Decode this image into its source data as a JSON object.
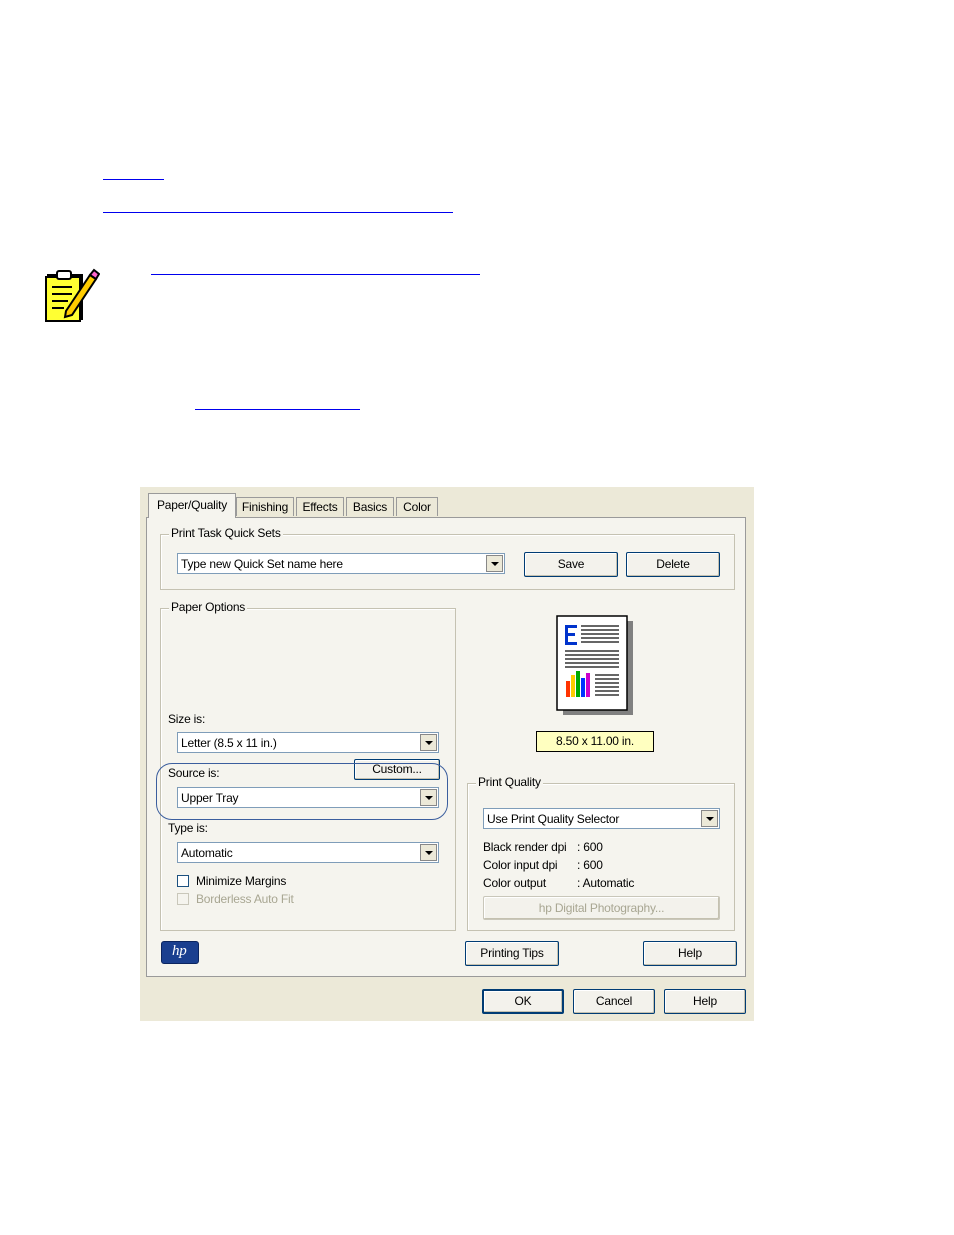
{
  "dialog": {
    "tabs": [
      {
        "label": "Paper/Quality",
        "active": true
      },
      {
        "label": "Finishing"
      },
      {
        "label": "Effects"
      },
      {
        "label": "Basics"
      },
      {
        "label": "Color"
      }
    ],
    "quick_sets": {
      "title": "Print Task Quick Sets",
      "value": "Type new Quick Set name here",
      "save_label": "Save",
      "delete_label": "Delete"
    },
    "paper_options": {
      "title": "Paper Options",
      "size_label": "Size is:",
      "size_value": "Letter (8.5 x 11 in.)",
      "custom_label": "Custom...",
      "source_label": "Source is:",
      "source_value": "Upper Tray",
      "type_label": "Type is:",
      "type_value": "Automatic",
      "minimize_margins_label": "Minimize Margins",
      "borderless_label": "Borderless Auto Fit"
    },
    "preview": {
      "size_text": "8.50 x 11.00 in."
    },
    "print_quality": {
      "title": "Print Quality",
      "value": "Use Print Quality Selector",
      "rows": [
        {
          "key": "Black render dpi",
          "value": ": 600"
        },
        {
          "key": "Color input dpi",
          "value": ": 600"
        },
        {
          "key": "Color output",
          "value": ": Automatic"
        }
      ],
      "photo_button": "hp Digital Photography..."
    },
    "printing_tips_label": "Printing Tips",
    "help_label": "Help",
    "ok_label": "OK",
    "cancel_label": "Cancel",
    "bottom_help_label": "Help",
    "logo_text": "hp",
    "highlight_color": "#3b5e9e",
    "preview_label_bg": "#ffffc0"
  }
}
